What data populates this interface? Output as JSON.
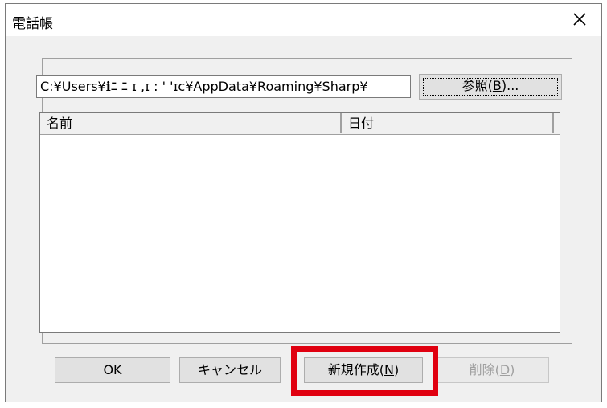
{
  "window": {
    "title": "電話帳",
    "close_icon": "close-icon"
  },
  "path": {
    "value": "C:¥Users¥ℹ︎ﾆ ﾆ ɪ ,ɪ : ' 'ɪc¥AppData¥Roaming¥Sharp¥"
  },
  "browse_button": {
    "label_main": "参照(",
    "label_key": "B",
    "label_tail": ")..."
  },
  "list": {
    "columns": [
      "名前",
      "日付"
    ],
    "rows": []
  },
  "buttons": {
    "ok": "OK",
    "cancel": "キャンセル",
    "new_main": "新規作成(",
    "new_key": "N",
    "new_tail": ")",
    "delete_main": "削除(",
    "delete_key": "D",
    "delete_tail": ")"
  },
  "colors": {
    "highlight": "#e00010",
    "dialog_bg": "#f0f0f0"
  }
}
